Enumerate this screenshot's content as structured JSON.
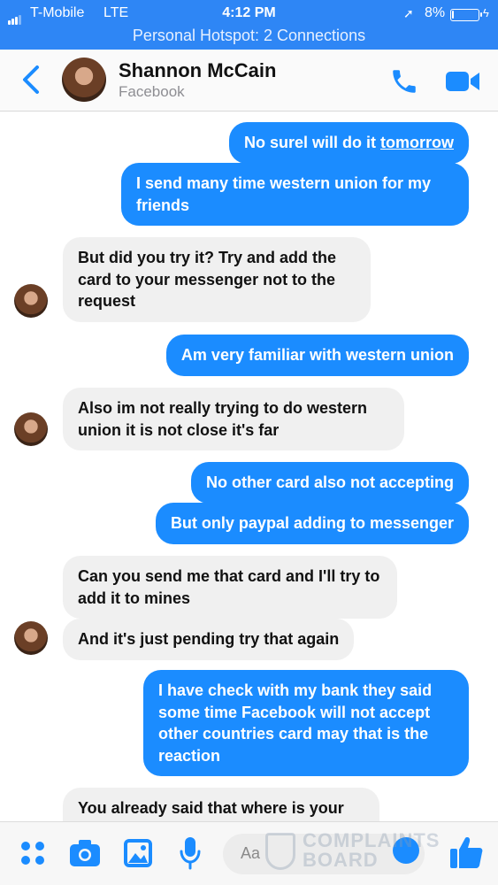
{
  "status_bar": {
    "carrier": "T-Mobile",
    "network": "LTE",
    "time": "4:12 PM",
    "battery": "8%",
    "battery_level": 0.08,
    "hotspot": "Personal Hotspot: 2 Connections"
  },
  "header": {
    "contact_name": "Shannon McCain",
    "subtitle": "Facebook"
  },
  "messages": [
    {
      "side": "out",
      "text": "No surel will  do it ",
      "link": "tomorrow"
    },
    {
      "side": "out",
      "text": "I send many time western union for my friends"
    },
    {
      "side": "in",
      "text": "But did you try it? Try and add the card to your messenger not to the request"
    },
    {
      "side": "out",
      "text": "Am very familiar with western union"
    },
    {
      "side": "in",
      "text": "Also im not really trying to do western union it is not close it's far"
    },
    {
      "side": "out",
      "text": "No other card also not accepting"
    },
    {
      "side": "out",
      "text": "But only paypal adding to messenger"
    },
    {
      "side": "in",
      "text": "Can you send me that card and I'll try to add it to mines"
    },
    {
      "side": "in",
      "text": "And it's just pending try that again"
    },
    {
      "side": "out",
      "text": "I have check with my bank they said some time Facebook will not accept other countries card may that is the reaction"
    },
    {
      "side": "in",
      "text": "You already said that where is your friend card ?"
    }
  ],
  "composer": {
    "placeholder": "Aa"
  },
  "watermark": {
    "text": "COMPLAINTS BOARD"
  },
  "colors": {
    "accent": "#2e86f5",
    "bubble_out": "#1b8cff",
    "bubble_in": "#f0f0f0"
  }
}
